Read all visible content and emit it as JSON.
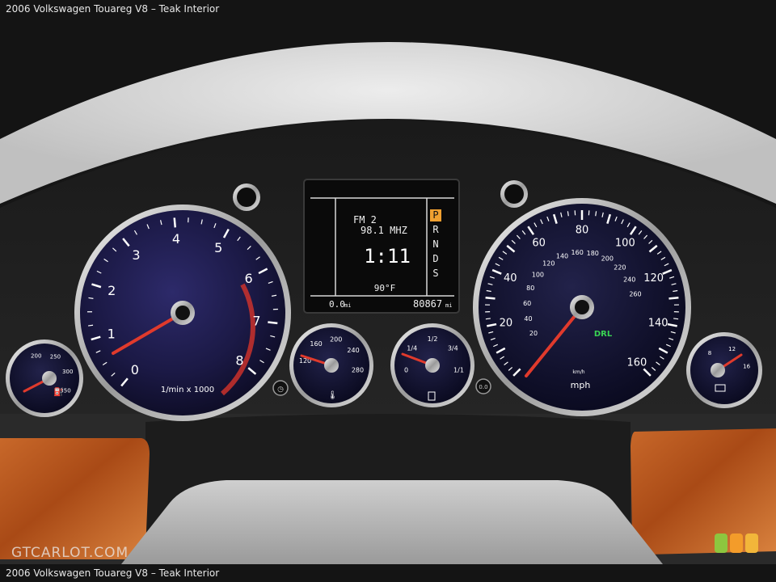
{
  "header": {
    "title": "2006 Volkswagen Touareg V8 – Teak Interior"
  },
  "footer": {
    "caption": "2006 Volkswagen Touareg V8 – Teak Interior"
  },
  "watermark": {
    "text": "GTCARLOT.COM"
  },
  "rating": {
    "colors": [
      "#8dc63f",
      "#f39c2a",
      "#f2b63a"
    ]
  },
  "display": {
    "radio_band": "FM 2",
    "frequency": "98.1 MHZ",
    "clock": "1:11",
    "temperature": "90°F",
    "trip": "0.0",
    "trip_unit": "mi",
    "odometer": "80867",
    "odometer_unit": "mi",
    "gear_selected": "P",
    "gears": [
      "P",
      "R",
      "N",
      "D",
      "S"
    ]
  },
  "tachometer": {
    "labels": [
      "0",
      "1",
      "2",
      "3",
      "4",
      "5",
      "6",
      "7",
      "8"
    ],
    "unit_label": "1/min x 1000",
    "reading": 0.8
  },
  "speedometer": {
    "mph_labels": [
      "20",
      "40",
      "60",
      "80",
      "100",
      "120",
      "140",
      "160"
    ],
    "kmh_labels": [
      "20",
      "40",
      "60",
      "80",
      "100",
      "120",
      "140",
      "160",
      "180",
      "200",
      "220",
      "240",
      "260"
    ],
    "unit_label": "mph",
    "kmh_unit": "km/h",
    "indicator": "DRL",
    "indicator_color": "#39d353",
    "reading": 0
  },
  "oil_temp_gauge": {
    "labels": [
      "200",
      "250",
      "300",
      "350"
    ]
  },
  "coolant_gauge": {
    "labels": [
      "120",
      "160",
      "200",
      "240",
      "280"
    ]
  },
  "fuel_gauge": {
    "labels": [
      "0",
      "1/4",
      "1/2",
      "3/4",
      "1/1"
    ]
  },
  "voltage_gauge": {
    "labels": [
      "8",
      "12",
      "16"
    ]
  },
  "trip_reset_label": "0.0"
}
